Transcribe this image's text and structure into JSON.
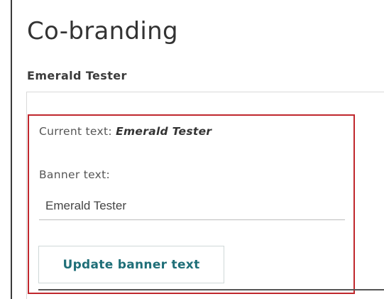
{
  "page": {
    "title": "Co-branding",
    "subtitle": "Emerald Tester"
  },
  "form": {
    "current_text_label": "Current text:",
    "current_text_value": "Emerald Tester",
    "banner_label": "Banner text:",
    "banner_input_value": "Emerald Tester",
    "update_button_label": "Update banner text"
  },
  "colors": {
    "highlight_border": "#c0272d",
    "button_text": "#1f6f78"
  }
}
